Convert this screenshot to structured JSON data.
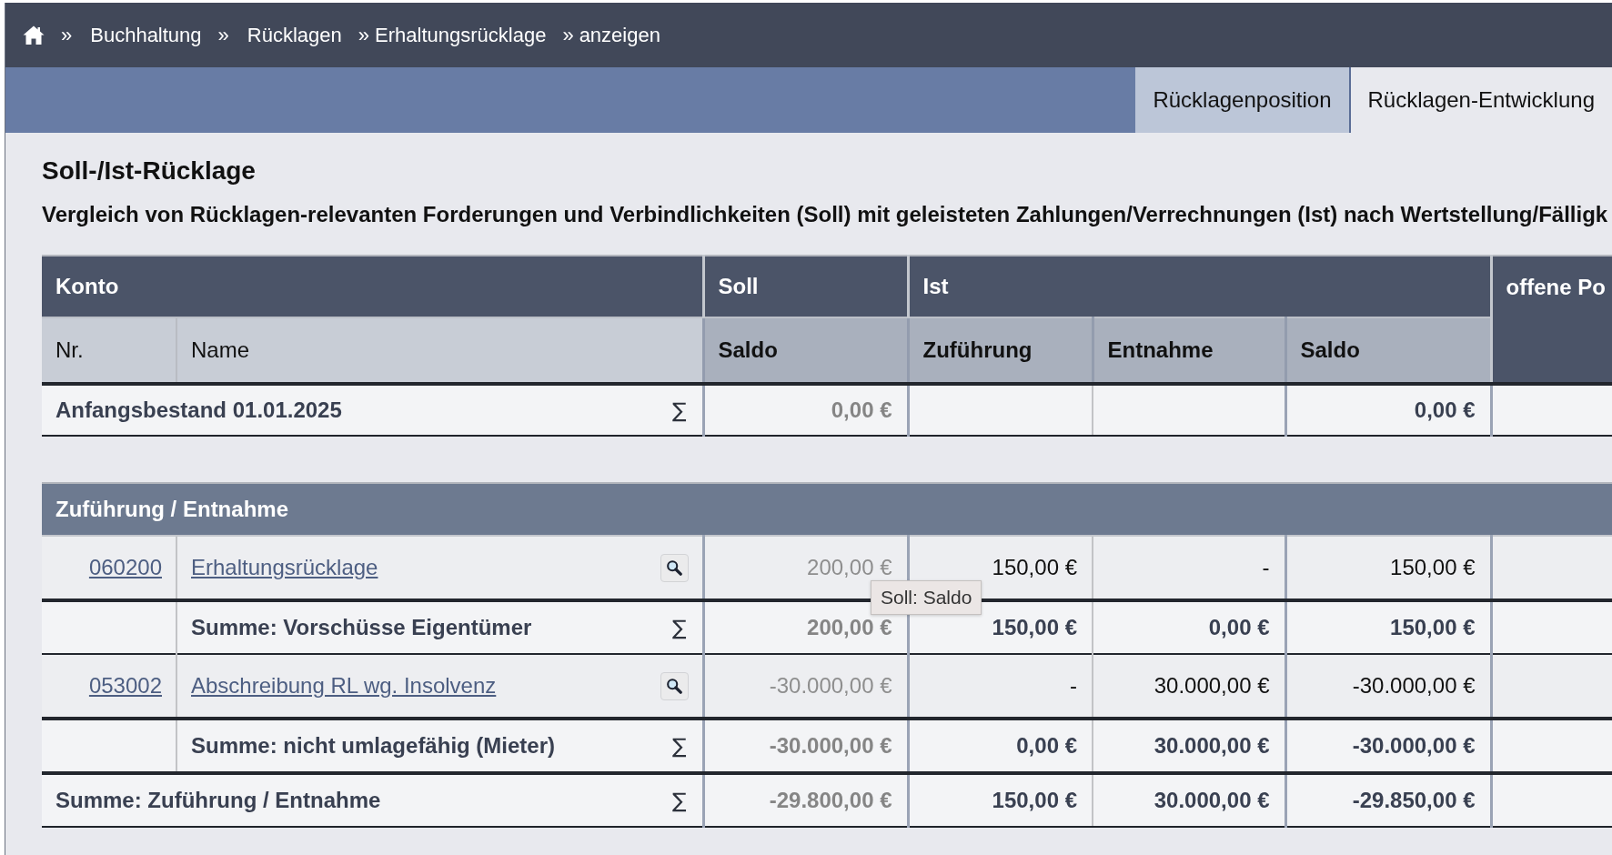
{
  "breadcrumb": [
    {
      "separator": "»",
      "label": "Buchhaltung",
      "kind": "link"
    },
    {
      "separator": "»",
      "label": "Rücklagen",
      "kind": "link"
    },
    {
      "separator": "»",
      "label": "Erhaltungsrücklage",
      "kind": "text"
    },
    {
      "separator": "»",
      "label": "anzeigen",
      "kind": "text"
    }
  ],
  "tabs": [
    {
      "label": "Rücklagenposition",
      "selected": false
    },
    {
      "label": "Rücklagen-Entwicklung",
      "selected": true
    }
  ],
  "title": "Soll-/Ist-Rücklage",
  "description": "Vergleich von Rücklagen-relevanten Forderungen und Verbindlichkeiten (Soll) mit geleisteten Zahlungen/Verrechnungen (Ist) nach Wertstellung/Fälligk",
  "table": {
    "column_groups": [
      {
        "label": "Konto",
        "columns": [
          "Nr.",
          "Name"
        ]
      },
      {
        "label": "Soll",
        "columns": [
          "Saldo"
        ]
      },
      {
        "label": "Ist",
        "columns": [
          "Zuführung",
          "Entnahme",
          "Saldo"
        ]
      },
      {
        "label": "offene Po"
      }
    ],
    "rows": [
      {
        "kind": "total",
        "label": "Anfangsbestand 01.01.2025",
        "sum_sign": "∑",
        "soll_saldo": "0,00 €",
        "ist_saldo": "0,00 €"
      }
    ],
    "sections": [
      {
        "title": "Zuführung / Entnahme",
        "rows": [
          {
            "kind": "account",
            "nr": "060200",
            "name": "Erhaltungsrücklage",
            "soll_saldo": "200,00 €",
            "ist_zufuehrung": "150,00 €",
            "ist_entnahme": "-",
            "ist_saldo": "150,00 €"
          },
          {
            "kind": "subtotal",
            "label": "Summe: Vorschüsse Eigentümer",
            "sum_sign": "∑",
            "soll_saldo": "200,00 €",
            "ist_zufuehrung": "150,00 €",
            "ist_entnahme": "0,00 €",
            "ist_saldo": "150,00 €"
          },
          {
            "kind": "account",
            "nr": "053002",
            "name": "Abschreibung RL wg. Insolvenz",
            "soll_saldo": "-30.000,00 €",
            "ist_zufuehrung": "-",
            "ist_entnahme": "30.000,00 €",
            "ist_saldo": "-30.000,00 €"
          },
          {
            "kind": "subtotal",
            "label": "Summe: nicht umlagefähig (Mieter)",
            "sum_sign": "∑",
            "soll_saldo": "-30.000,00 €",
            "ist_zufuehrung": "0,00 €",
            "ist_entnahme": "30.000,00 €",
            "ist_saldo": "-30.000,00 €"
          },
          {
            "kind": "total",
            "label": "Summe: Zuführung / Entnahme",
            "sum_sign": "∑",
            "soll_saldo": "-29.800,00 €",
            "ist_zufuehrung": "150,00 €",
            "ist_entnahme": "30.000,00 €",
            "ist_saldo": "-29.850,00 €"
          }
        ]
      }
    ]
  },
  "tooltip": {
    "text": "Soll: Saldo"
  }
}
